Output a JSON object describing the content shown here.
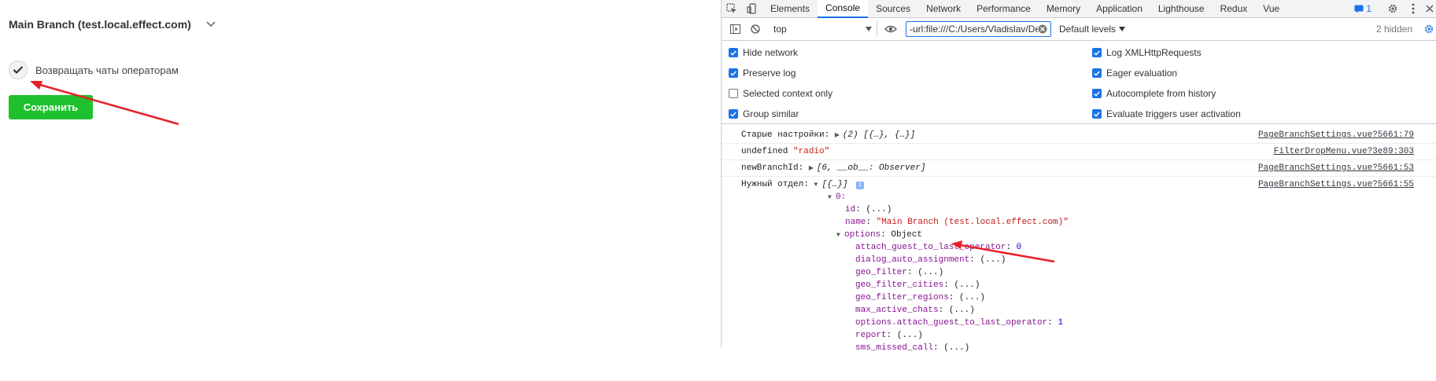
{
  "app": {
    "branch_title": "Main Branch (test.local.effect.com)",
    "checkbox_label": "Возвращать чаты операторам",
    "checkbox_checked": true,
    "save_label": "Сохранить",
    "save_color": "#1ec12d"
  },
  "devtools": {
    "tabs": [
      "Elements",
      "Console",
      "Sources",
      "Network",
      "Performance",
      "Memory",
      "Application",
      "Lighthouse",
      "Redux",
      "Vue"
    ],
    "active_tab": "Console",
    "issues_count": "1",
    "toolbar": {
      "context": "top",
      "filter_value": "-url:file:///C:/Users/Vladislav/Des",
      "levels": "Default levels",
      "hidden": "2 hidden"
    },
    "settings_left": [
      {
        "label": "Hide network",
        "checked": true
      },
      {
        "label": "Preserve log",
        "checked": true
      },
      {
        "label": "Selected context only",
        "checked": false
      },
      {
        "label": "Group similar",
        "checked": true
      }
    ],
    "settings_right": [
      {
        "label": "Log XMLHttpRequests",
        "checked": true
      },
      {
        "label": "Eager evaluation",
        "checked": true
      },
      {
        "label": "Autocomplete from history",
        "checked": true
      },
      {
        "label": "Evaluate triggers user activation",
        "checked": true
      }
    ],
    "console": {
      "msg1_label": "Старые настройки:",
      "msg1_value": "(2) [{…}, {…}]",
      "msg1_src": "PageBranchSettings.vue?5661:79",
      "msg2_label": "undefined",
      "msg2_value": "\"radio\"",
      "msg2_src": "FilterDropMenu.vue?3e89:303",
      "msg3_label": "newBranchId:",
      "msg3_value": "[6, __ob__: Observer]",
      "msg3_src": "PageBranchSettings.vue?5661:53",
      "msg4_label": "Нужный отдел:",
      "msg4_value": "[{…}]",
      "msg4_src": "PageBranchSettings.vue?5661:55",
      "tree": {
        "index": "0:",
        "id_key": "id",
        "id_val": "(...)",
        "name_key": "name",
        "name_val": "\"Main Branch (test.local.effect.com)\"",
        "options_key": "options",
        "options_val": "Object",
        "options_items": [
          {
            "key": "attach_guest_to_last_operator",
            "val": "0",
            "type": "num"
          },
          {
            "key": "dialog_auto_assignment",
            "val": "(...)",
            "type": "plain"
          },
          {
            "key": "geo_filter",
            "val": "(...)",
            "type": "plain"
          },
          {
            "key": "geo_filter_cities",
            "val": "(...)",
            "type": "plain"
          },
          {
            "key": "geo_filter_regions",
            "val": "(...)",
            "type": "plain"
          },
          {
            "key": "max_active_chats",
            "val": "(...)",
            "type": "plain"
          },
          {
            "key": "options.attach_guest_to_last_operator",
            "val": "1",
            "type": "num"
          },
          {
            "key": "report",
            "val": "(...)",
            "type": "plain"
          },
          {
            "key": "sms_missed_call",
            "val": "(...)",
            "type": "plain"
          }
        ]
      }
    }
  },
  "annotation_color": "#e8202a"
}
